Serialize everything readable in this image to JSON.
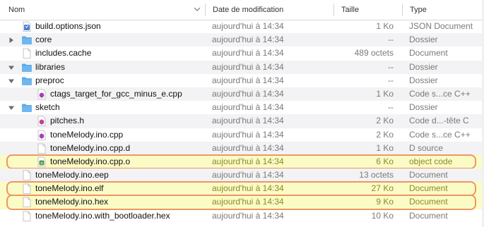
{
  "columns": {
    "name": "Nom",
    "date": "Date de modification",
    "size": "Taille",
    "type": "Type"
  },
  "colors": {
    "highlight_fill": "#fbfbc6",
    "highlight_border": "#ee9663",
    "folder_blue": "#5aa9e6"
  },
  "rows": [
    {
      "name": "build.options.json",
      "date": "aujourd'hui à 14:34",
      "size": "1 Ko",
      "type": "JSON Document",
      "icon": "json-file-icon",
      "indent": 1,
      "disclosure": "none",
      "highlight": false
    },
    {
      "name": "core",
      "date": "aujourd'hui à 14:34",
      "size": "--",
      "type": "Dossier",
      "icon": "folder-icon",
      "indent": 1,
      "disclosure": "collapsed",
      "highlight": false
    },
    {
      "name": "includes.cache",
      "date": "aujourd'hui à 14:34",
      "size": "489 octets",
      "type": "Document",
      "icon": "document-icon",
      "indent": 1,
      "disclosure": "none",
      "highlight": false
    },
    {
      "name": "libraries",
      "date": "aujourd'hui à 14:34",
      "size": "--",
      "type": "Dossier",
      "icon": "folder-icon",
      "indent": 1,
      "disclosure": "expanded",
      "highlight": false
    },
    {
      "name": "preproc",
      "date": "aujourd'hui à 14:34",
      "size": "--",
      "type": "Dossier",
      "icon": "folder-icon",
      "indent": 1,
      "disclosure": "expanded",
      "highlight": false
    },
    {
      "name": "ctags_target_for_gcc_minus_e.cpp",
      "date": "aujourd'hui à 14:34",
      "size": "1 Ko",
      "type": "Code s...ce C++",
      "icon": "cpp-file-icon",
      "indent": 2,
      "disclosure": "none",
      "highlight": false
    },
    {
      "name": "sketch",
      "date": "aujourd'hui à 14:34",
      "size": "--",
      "type": "Dossier",
      "icon": "folder-icon",
      "indent": 1,
      "disclosure": "expanded",
      "highlight": false
    },
    {
      "name": "pitches.h",
      "date": "aujourd'hui à 14:34",
      "size": "2 Ko",
      "type": "Code d...-tête C",
      "icon": "header-file-icon",
      "indent": 2,
      "disclosure": "none",
      "highlight": false
    },
    {
      "name": "toneMelody.ino.cpp",
      "date": "aujourd'hui à 14:34",
      "size": "2 Ko",
      "type": "Code s...ce C++",
      "icon": "cpp-file-icon",
      "indent": 2,
      "disclosure": "none",
      "highlight": false
    },
    {
      "name": "toneMelody.ino.cpp.d",
      "date": "aujourd'hui à 14:34",
      "size": "1 Ko",
      "type": "D source",
      "icon": "document-icon",
      "indent": 2,
      "disclosure": "none",
      "highlight": false
    },
    {
      "name": "toneMelody.ino.cpp.o",
      "date": "aujourd'hui à 14:34",
      "size": "6 Ko",
      "type": "object code",
      "icon": "object-file-icon",
      "indent": 2,
      "disclosure": "none",
      "highlight": true
    },
    {
      "name": "toneMelody.ino.eep",
      "date": "aujourd'hui à 14:34",
      "size": "13 octets",
      "type": "Document",
      "icon": "document-icon",
      "indent": 1,
      "disclosure": "none",
      "highlight": false
    },
    {
      "name": "toneMelody.ino.elf",
      "date": "aujourd'hui à 14:34",
      "size": "27 Ko",
      "type": "Document",
      "icon": "document-icon",
      "indent": 1,
      "disclosure": "none",
      "highlight": true
    },
    {
      "name": "toneMelody.ino.hex",
      "date": "aujourd'hui à 14:34",
      "size": "9 Ko",
      "type": "Document",
      "icon": "document-icon",
      "indent": 1,
      "disclosure": "none",
      "highlight": true
    },
    {
      "name": "toneMelody.ino.with_bootloader.hex",
      "date": "aujourd'hui à 14:34",
      "size": "10 Ko",
      "type": "Document",
      "icon": "document-icon",
      "indent": 1,
      "disclosure": "none",
      "highlight": false
    }
  ]
}
